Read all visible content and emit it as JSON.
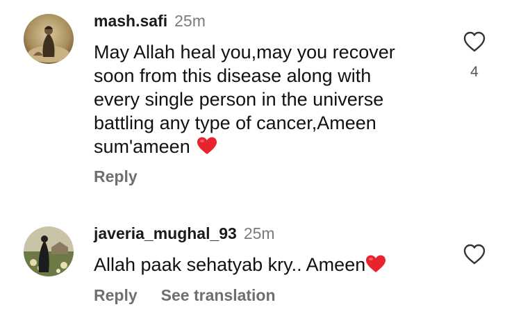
{
  "comments": [
    {
      "username": "mash.safi",
      "time": "25m",
      "text": "May Allah heal you,may you recover soon from this disease along with every single person in the universe battling any type of cancer,Ameen sum'ameen",
      "likes": "4",
      "reply_label": "Reply"
    },
    {
      "username": "javeria_mughal_93",
      "time": "25m",
      "text": "Allah paak sehatyab kry.. Ameen",
      "reply_label": "Reply",
      "translate_label": "See translation"
    }
  ],
  "colors": {
    "heart_emoji": "#e8232e",
    "muted_text": "#7b7b7b",
    "action_text": "#6f6f6f"
  },
  "icons": {
    "like": "heart-outline-icon",
    "emoji": "red-heart-emoji-icon"
  }
}
